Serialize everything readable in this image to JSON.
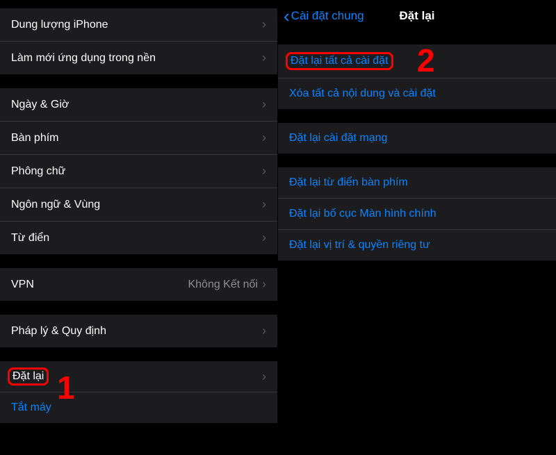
{
  "left": {
    "group1": [
      {
        "label": "Dung lượng iPhone"
      },
      {
        "label": "Làm mới ứng dụng trong nền"
      }
    ],
    "group2": [
      {
        "label": "Ngày & Giờ"
      },
      {
        "label": "Bàn phím"
      },
      {
        "label": "Phông chữ"
      },
      {
        "label": "Ngôn ngữ & Vùng"
      },
      {
        "label": "Từ điển"
      }
    ],
    "group3": [
      {
        "label": "VPN",
        "value": "Không Kết nối"
      }
    ],
    "group4": [
      {
        "label": "Pháp lý & Quy định"
      }
    ],
    "group5": {
      "reset": "Đặt lại",
      "shutdown": "Tắt máy"
    }
  },
  "right": {
    "header": {
      "back": "Cài đặt chung",
      "title": "Đặt lại"
    },
    "group1": [
      {
        "label": "Đặt lại tất cả cài đặt",
        "highlight": true
      },
      {
        "label": "Xóa tất cả nội dung và cài đặt"
      }
    ],
    "group2": [
      {
        "label": "Đặt lại cài đặt mạng"
      }
    ],
    "group3": [
      {
        "label": "Đặt lại từ điển bàn phím"
      },
      {
        "label": "Đặt lại bố cục Màn hình chính"
      },
      {
        "label": "Đặt lại vị trí & quyền riêng tư"
      }
    ]
  },
  "markers": {
    "one": "1",
    "two": "2"
  }
}
